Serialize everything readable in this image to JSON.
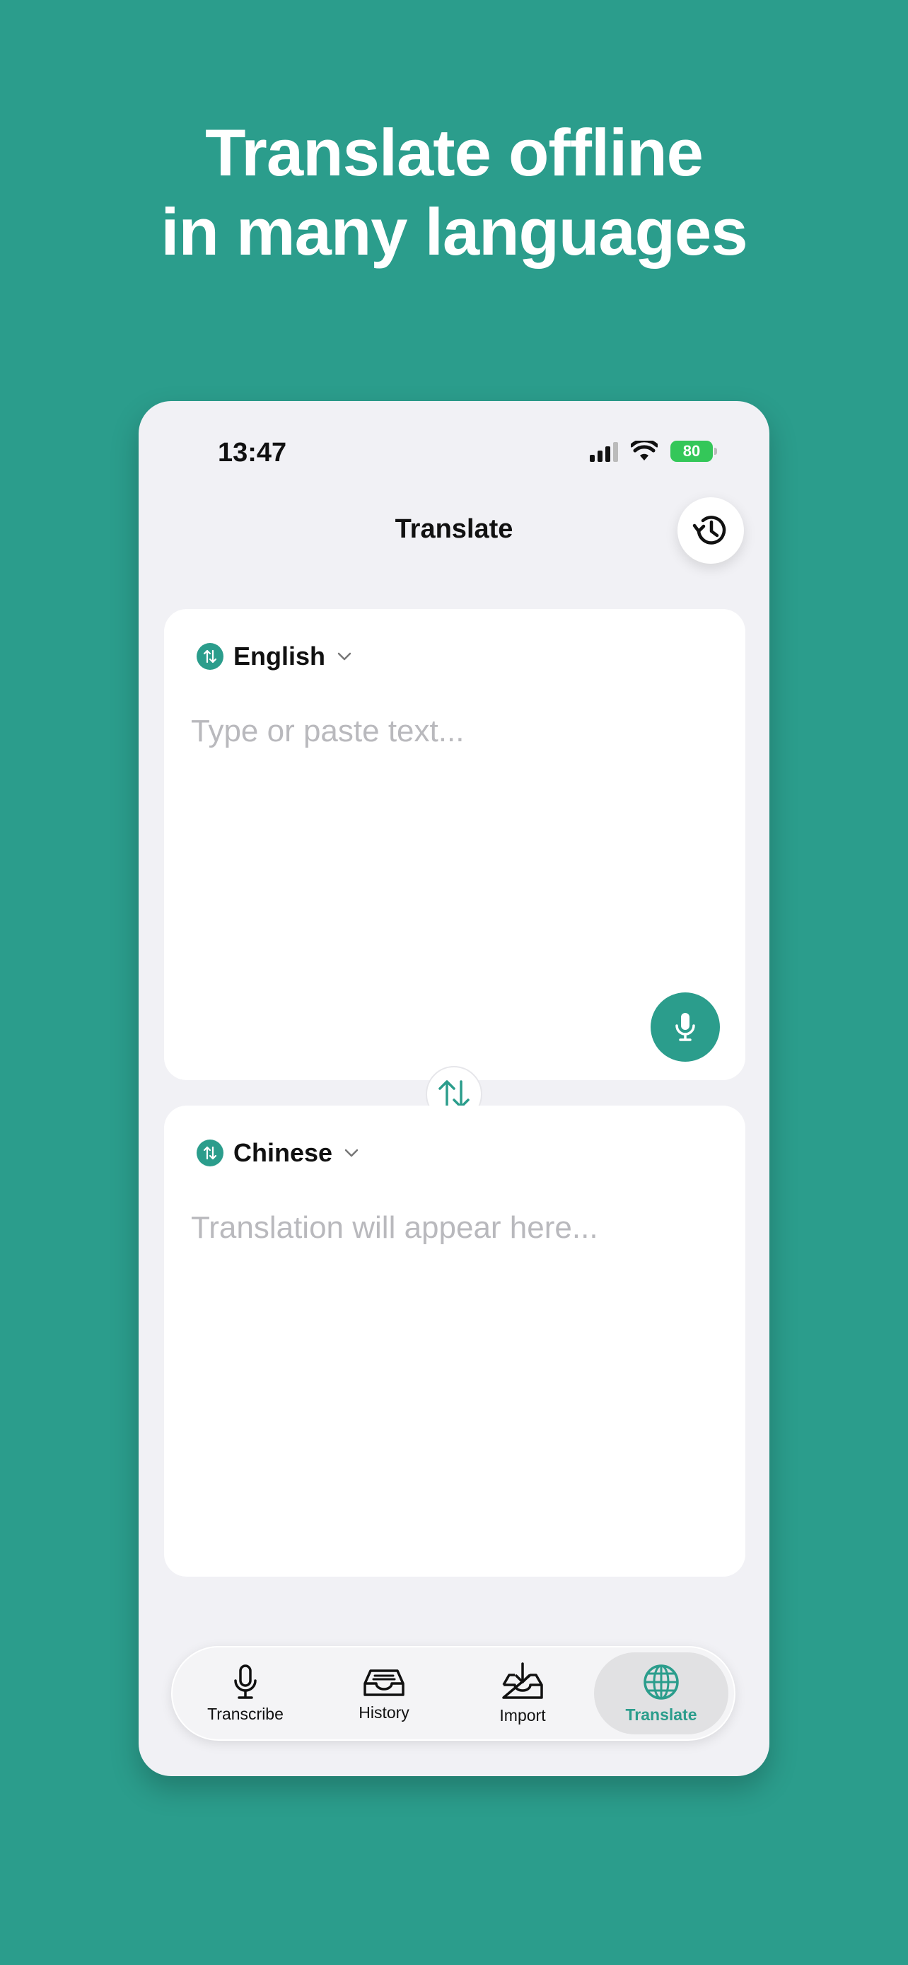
{
  "headline": {
    "line1": "Translate offline",
    "line2": "in many languages"
  },
  "status_bar": {
    "time": "13:47",
    "battery": "80"
  },
  "nav": {
    "title": "Translate",
    "history_icon": "history-clock-icon"
  },
  "source": {
    "language": "English",
    "placeholder": "Type or paste text..."
  },
  "target": {
    "language": "Chinese",
    "placeholder": "Translation will appear here..."
  },
  "tabs": [
    {
      "label": "Transcribe",
      "icon": "microphone-icon",
      "active": false
    },
    {
      "label": "History",
      "icon": "inbox-tray-icon",
      "active": false
    },
    {
      "label": "Import",
      "icon": "download-tray-icon",
      "active": false
    },
    {
      "label": "Translate",
      "icon": "globe-icon",
      "active": true
    }
  ],
  "colors": {
    "accent": "#2b9d8c",
    "background": "#2b9d8c",
    "battery": "#34c759"
  }
}
